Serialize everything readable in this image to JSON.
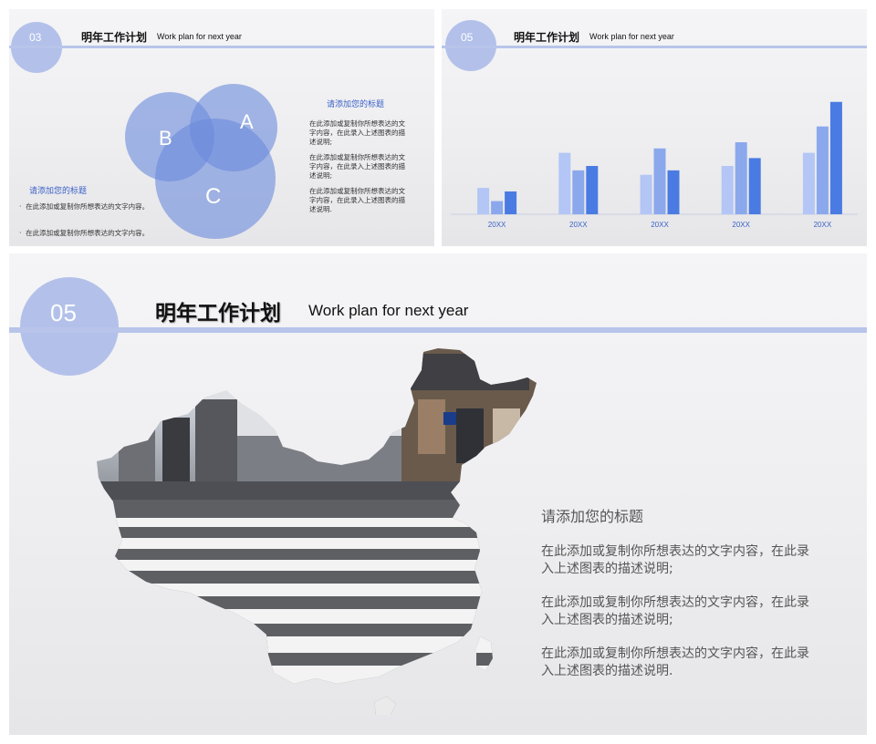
{
  "header": {
    "title_zh": "明年工作计划",
    "title_en": "Work plan for next year"
  },
  "slide1": {
    "number": "03",
    "venn": {
      "labels": [
        "A",
        "B",
        "C"
      ]
    },
    "left_block": {
      "heading": "请添加您的标题",
      "bullets": [
        "在此添加或复制你所想表达的文字内容。",
        "在此添加或复制你所想表达的文字内容。"
      ]
    },
    "right_block": {
      "heading": "请添加您的标题",
      "paras": [
        "在此添加或复制你所想表达的文字内容，在此录入上述图表的描述说明;",
        "在此添加或复制你所想表达的文字内容，在此录入上述图表的描述说明;",
        "在此添加或复制你所想表达的文字内容，在此录入上述图表的描述说明."
      ]
    }
  },
  "slide2": {
    "number": "05",
    "chart_data": {
      "type": "bar",
      "categories": [
        "20XX",
        "20XX",
        "20XX",
        "20XX",
        "20XX"
      ],
      "series": [
        {
          "values": [
            30,
            70,
            45,
            55,
            70
          ]
        },
        {
          "values": [
            15,
            50,
            75,
            82,
            100
          ]
        },
        {
          "values": [
            26,
            55,
            50,
            64,
            128
          ]
        }
      ],
      "colors": [
        "#b3c6f5",
        "#8ba8ec",
        "#4a7be3"
      ],
      "ylim": [
        0,
        135
      ],
      "grid": false
    }
  },
  "slide3": {
    "number": "05",
    "heading": "请添加您的标题",
    "paras": [
      "在此添加或复制你所想表达的文字内容，在此录入上述图表的描述说明;",
      "在此添加或复制你所想表达的文字内容，在此录入上述图表的描述说明;",
      "在此添加或复制你所想表达的文字内容，在此录入上述图表的描述说明."
    ],
    "map_photo": "china-map-street-crosswalk-photo"
  },
  "colors": {
    "accent": "#b3c1ea",
    "venn_fill": "#6a8bdc",
    "heading_blue": "#3c62c8"
  }
}
